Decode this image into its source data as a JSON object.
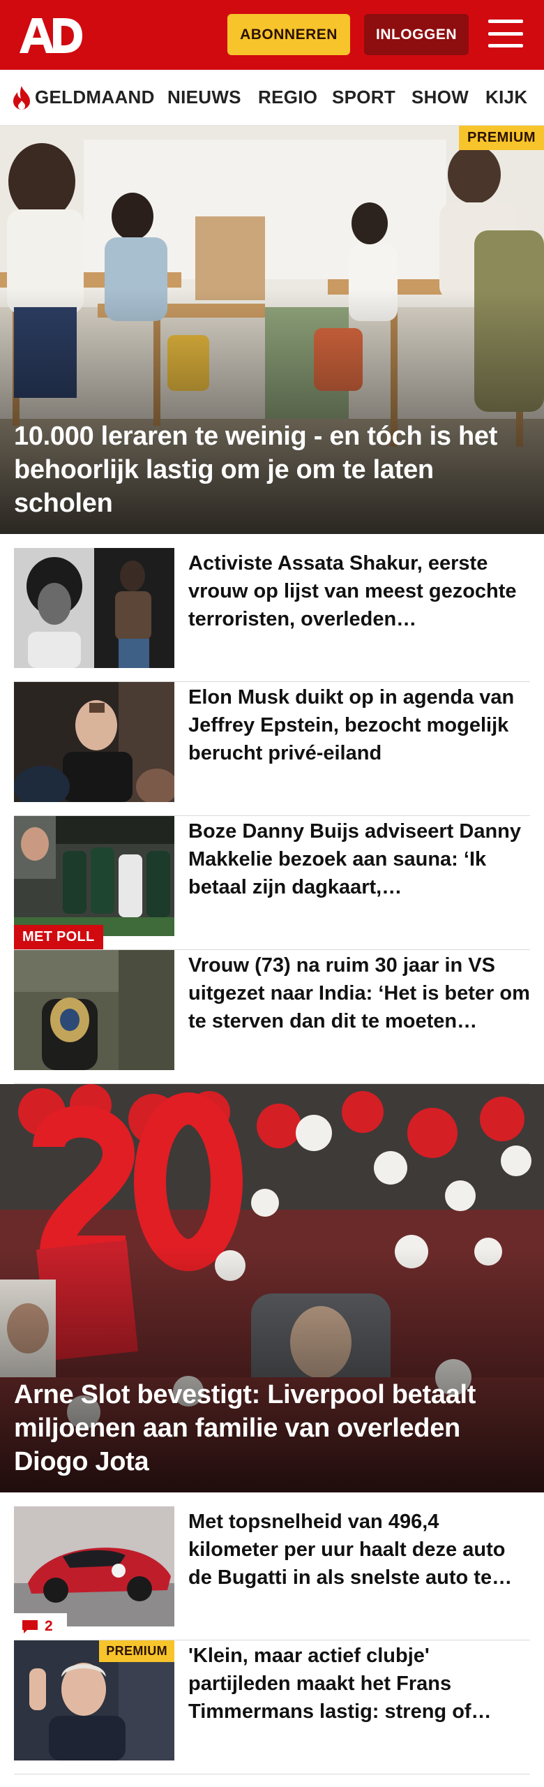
{
  "header": {
    "logo_text": "AD",
    "subscribe_label": "ABONNEREN",
    "login_label": "INLOGGEN",
    "brand_color": "#d10a10",
    "menu_icon": "hamburger-menu-icon"
  },
  "nav": {
    "items": [
      {
        "label": "GELDMAAND",
        "icon": "flame-icon"
      },
      {
        "label": "NIEUWS"
      },
      {
        "label": "REGIO"
      },
      {
        "label": "SPORT"
      },
      {
        "label": "SHOW"
      },
      {
        "label": "KIJK"
      }
    ]
  },
  "hero1": {
    "tag": "PREMIUM",
    "title": "10.000 leraren te weinig - en tóch is het behoorlijk lastig om je om te laten scholen"
  },
  "list1": [
    {
      "title": "Activiste Assata Shakur, eerste vrouw op lijst van meest gezochte terroristen, overleden…"
    },
    {
      "title": "Elon Musk duikt op in agenda van Jeffrey Epstein, bezocht mogelijk berucht privé-eiland"
    },
    {
      "title": "Boze Danny Buijs adviseert Danny Makkelie bezoek aan sauna: ‘Ik betaal zijn dagkaart,…",
      "badge": "MET POLL"
    },
    {
      "title": "Vrouw (73) na ruim 30 jaar in VS uitgezet naar India: ‘Het is beter om te sterven dan dit te moeten…"
    }
  ],
  "hero2": {
    "title": "Arne Slot bevestigt: Liverpool betaalt miljoenen aan familie van overleden Diogo Jota"
  },
  "list2": [
    {
      "title": "Met topsnelheid van 496,4 kilometer per uur haalt deze auto de Bugatti in als snelste auto te…",
      "comments": "2"
    },
    {
      "title": "'Klein, maar actief clubje' partijleden maakt het Frans Timmermans lastig: streng of…",
      "tag": "PREMIUM"
    }
  ]
}
